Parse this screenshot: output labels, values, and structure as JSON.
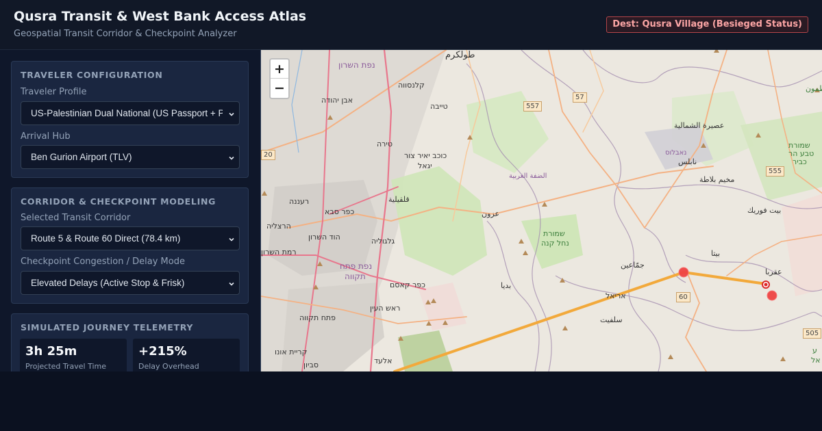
{
  "header": {
    "title": "Qusra Transit & West Bank Access Atlas",
    "subtitle": "Geospatial Transit Corridor & Checkpoint Analyzer",
    "destination_badge": "Dest: Qusra Village (Besieged Status)"
  },
  "traveler": {
    "heading": "TRAVELER CONFIGURATION",
    "profile_label": "Traveler Profile",
    "profile_value": "US-Palestinian Dual National (US Passport + PA ID)",
    "hub_label": "Arrival Hub",
    "hub_value": "Ben Gurion Airport (TLV)"
  },
  "corridor": {
    "heading": "CORRIDOR & CHECKPOINT MODELING",
    "corridor_label": "Selected Transit Corridor",
    "corridor_value": "Route 5 & Route 60 Direct (78.4 km)",
    "delay_label": "Checkpoint Congestion / Delay Mode",
    "delay_value": "Elevated Delays (Active Stop & Frisk)"
  },
  "telemetry": {
    "heading": "SIMULATED JOURNEY TELEMETRY",
    "metrics": [
      {
        "value": "3h 25m",
        "label": "Projected Travel Time"
      },
      {
        "value": "+215%",
        "label": "Delay Overhead"
      }
    ]
  },
  "map": {
    "zoom_in": "+",
    "zoom_out": "−",
    "labels": {
      "tulkarm": "طولكرم",
      "qalansawe": "קלנסווה",
      "tayibe": "טייבה",
      "tira": "טירה",
      "kochav_yair": "כוכב יאיר צור",
      "yigal": "יגאל",
      "qalqilya": "قلقيلية",
      "raanana": "רעננה",
      "kfar_saba": "כפר סבא",
      "herzliya": "הרצליה",
      "hod_hasharon": "הוד השרון",
      "ramat_hasharon": "רמת השרון",
      "givat_shmuel": "גלגוליה",
      "petah_tikva_nafa": "נפת פתח",
      "petah_tikva_nafa2": "תקווה",
      "kfar_qasem": "כפר קאסם",
      "rosh_haayin": "ראש העין",
      "petah_tikva": "פתח תקווה",
      "kiryat_ono": "קריית אונו",
      "savyon": "סביון",
      "elad": "אלעד",
      "nafat_hasharon": "נפת השרון",
      "even_yehuda": "אבן יהודה",
      "azzun": "عزون",
      "nahal_kana_1": "שמורת",
      "nahal_kana_2": "נחל קנה",
      "westbank": "الضفة الغربية",
      "jammain": "جمّاعين",
      "ariel": "אריאל",
      "salfit": "سلفيت",
      "bidya": "بديا",
      "beita": "بيتا",
      "aqraba": "عقربا",
      "nablus_he": "נאבלוס",
      "nablus": "نابلس",
      "askar": "عصيرة الشمالية",
      "mukhayyam": "مخيم بلاطة",
      "beit_furik": "بيت فوريك",
      "reserve_1": "שמורת",
      "reserve_2": "טבע הר",
      "reserve_3": "כביר",
      "tammun": "طمون",
      "anu": "ונו",
      "edge_e": "ע",
      "edge_al": "אל"
    },
    "shields": [
      "557",
      "57",
      "555",
      "60",
      "505",
      "20"
    ]
  },
  "colors": {
    "route": "#f2a93b",
    "checkpoint": "#ef4444",
    "badge_border": "#b4454a"
  }
}
